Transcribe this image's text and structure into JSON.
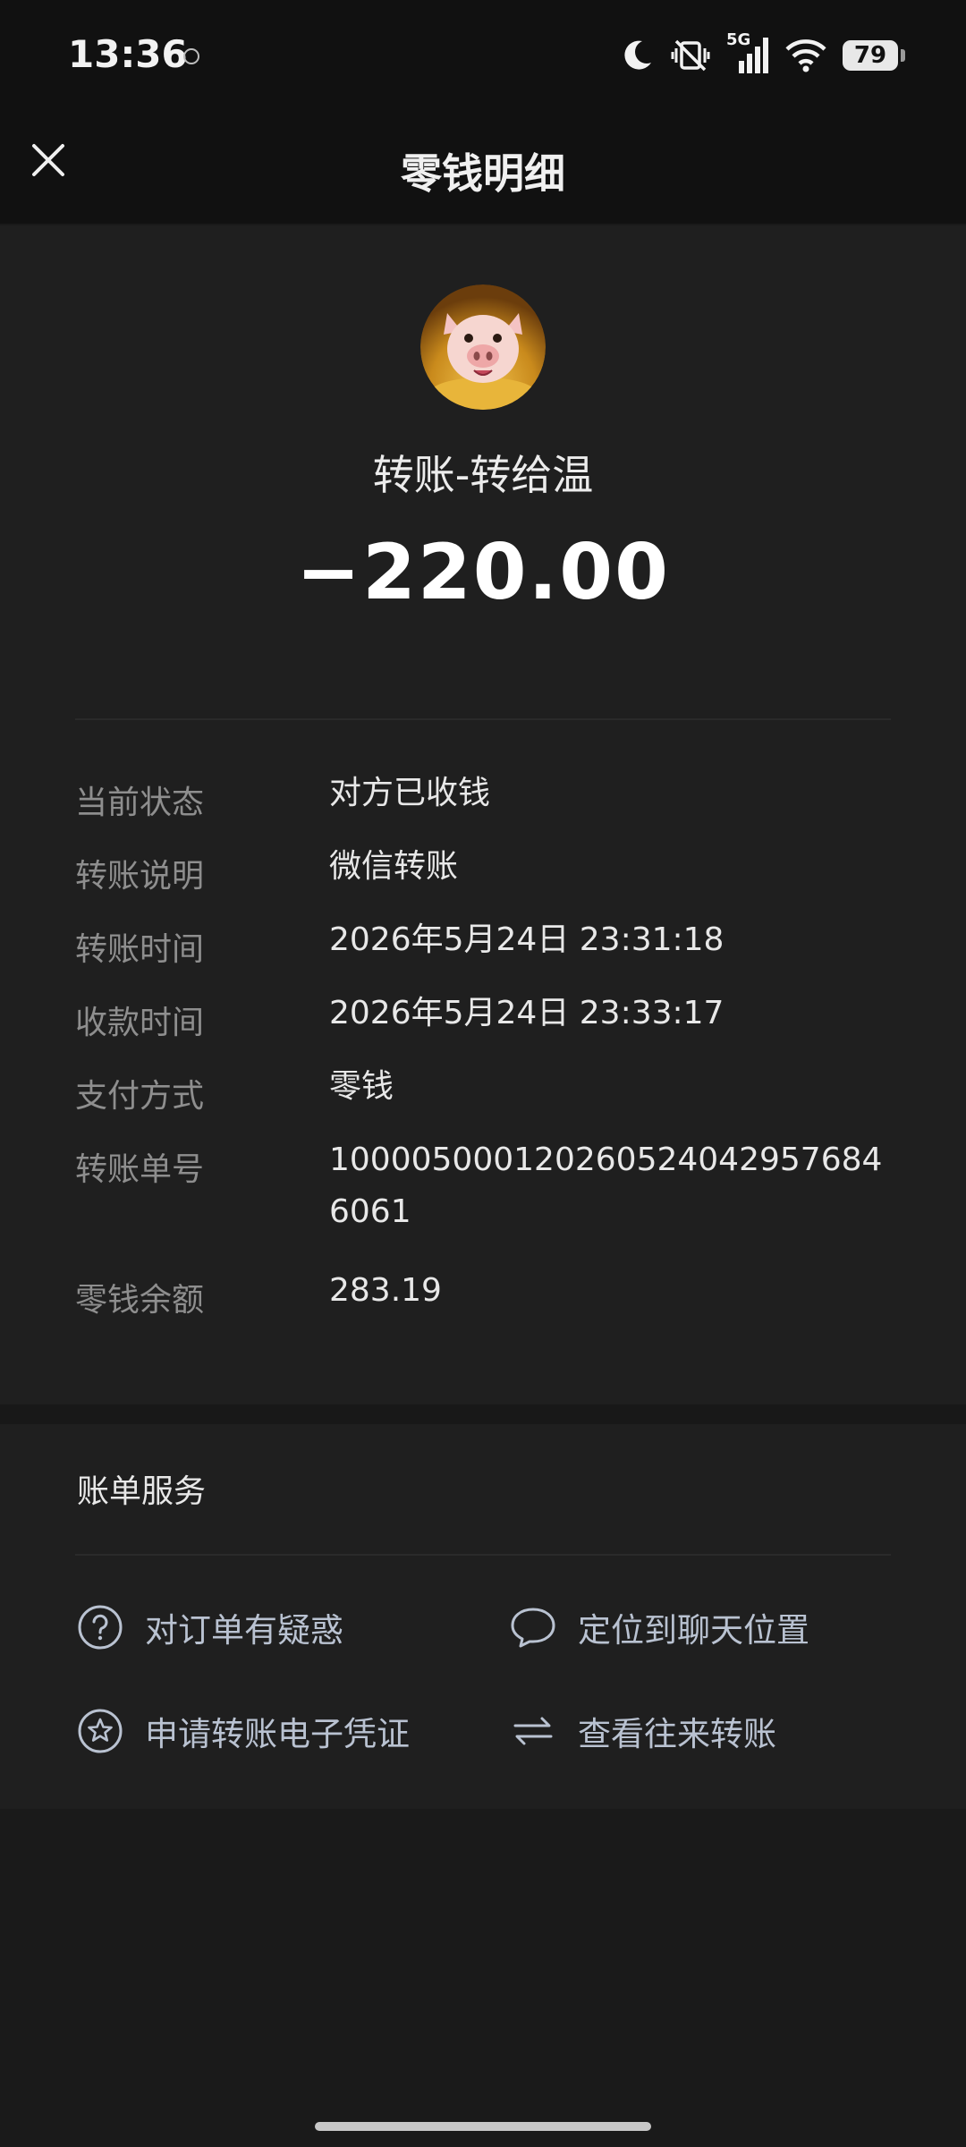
{
  "status_bar": {
    "time": "13:36",
    "network": "5G",
    "battery": "79",
    "icons": [
      "moon-icon",
      "mute-vibrate-icon",
      "signal-icon",
      "wifi-icon",
      "battery-icon"
    ]
  },
  "header": {
    "title": "零钱明细",
    "close_icon": "close-icon"
  },
  "transaction": {
    "avatar_icon": "pig-avatar",
    "payee": "转账-转给温",
    "amount": "−220.00"
  },
  "details": [
    {
      "label": "当前状态",
      "value": "对方已收钱"
    },
    {
      "label": "转账说明",
      "value": "微信转账"
    },
    {
      "label": "转账时间",
      "value": "2026年5月24日 23:31:18"
    },
    {
      "label": "收款时间",
      "value": "2026年5月24日 23:33:17"
    },
    {
      "label": "支付方式",
      "value": "零钱"
    },
    {
      "label": "转账单号",
      "value": "100005000120260524042957684 6061"
    },
    {
      "label": "零钱余额",
      "value": "283.19"
    }
  ],
  "services": {
    "title": "账单服务",
    "items": [
      {
        "label": "对订单有疑惑",
        "icon": "question-circle-icon"
      },
      {
        "label": "定位到聊天位置",
        "icon": "chat-bubble-icon"
      },
      {
        "label": "申请转账电子凭证",
        "icon": "star-circle-icon"
      },
      {
        "label": "查看往来转账",
        "icon": "swap-arrows-icon"
      }
    ]
  },
  "colors": {
    "background": "#1a1a1a",
    "header": "#111111",
    "card": "#1f1f1f",
    "label": "#8e8e8e",
    "link": "#b9c2d1"
  }
}
